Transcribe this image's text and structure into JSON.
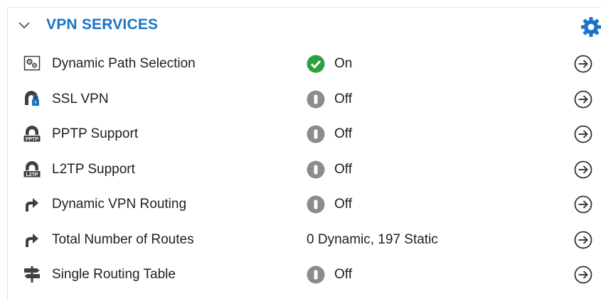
{
  "section": {
    "title": "VPN SERVICES"
  },
  "colors": {
    "title": "#1a74c8",
    "gear": "#1a74c8",
    "status_on": "#2ea043",
    "status_off": "#8c8c8c"
  },
  "rows": [
    {
      "label": "Dynamic Path Selection",
      "status": "On",
      "status_icon": "check-circle-icon",
      "row_icon": "path-selection-icon"
    },
    {
      "label": "SSL VPN",
      "status": "Off",
      "status_icon": "off-circle-icon",
      "row_icon": "ssl-vpn-lock-icon"
    },
    {
      "label": "PPTP Support",
      "status": "Off",
      "status_icon": "off-circle-icon",
      "row_icon": "pptp-icon",
      "row_icon_text": "PPTP"
    },
    {
      "label": "L2TP Support",
      "status": "Off",
      "status_icon": "off-circle-icon",
      "row_icon": "l2tp-icon",
      "row_icon_text": "L2TP"
    },
    {
      "label": "Dynamic VPN Routing",
      "status": "Off",
      "status_icon": "off-circle-icon",
      "row_icon": "routing-arrow-icon"
    },
    {
      "label": "Total Number of Routes",
      "status": "0 Dynamic, 197 Static",
      "status_icon": null,
      "row_icon": "routing-arrow-icon"
    },
    {
      "label": "Single Routing Table",
      "status": "Off",
      "status_icon": "off-circle-icon",
      "row_icon": "signpost-icon"
    }
  ]
}
